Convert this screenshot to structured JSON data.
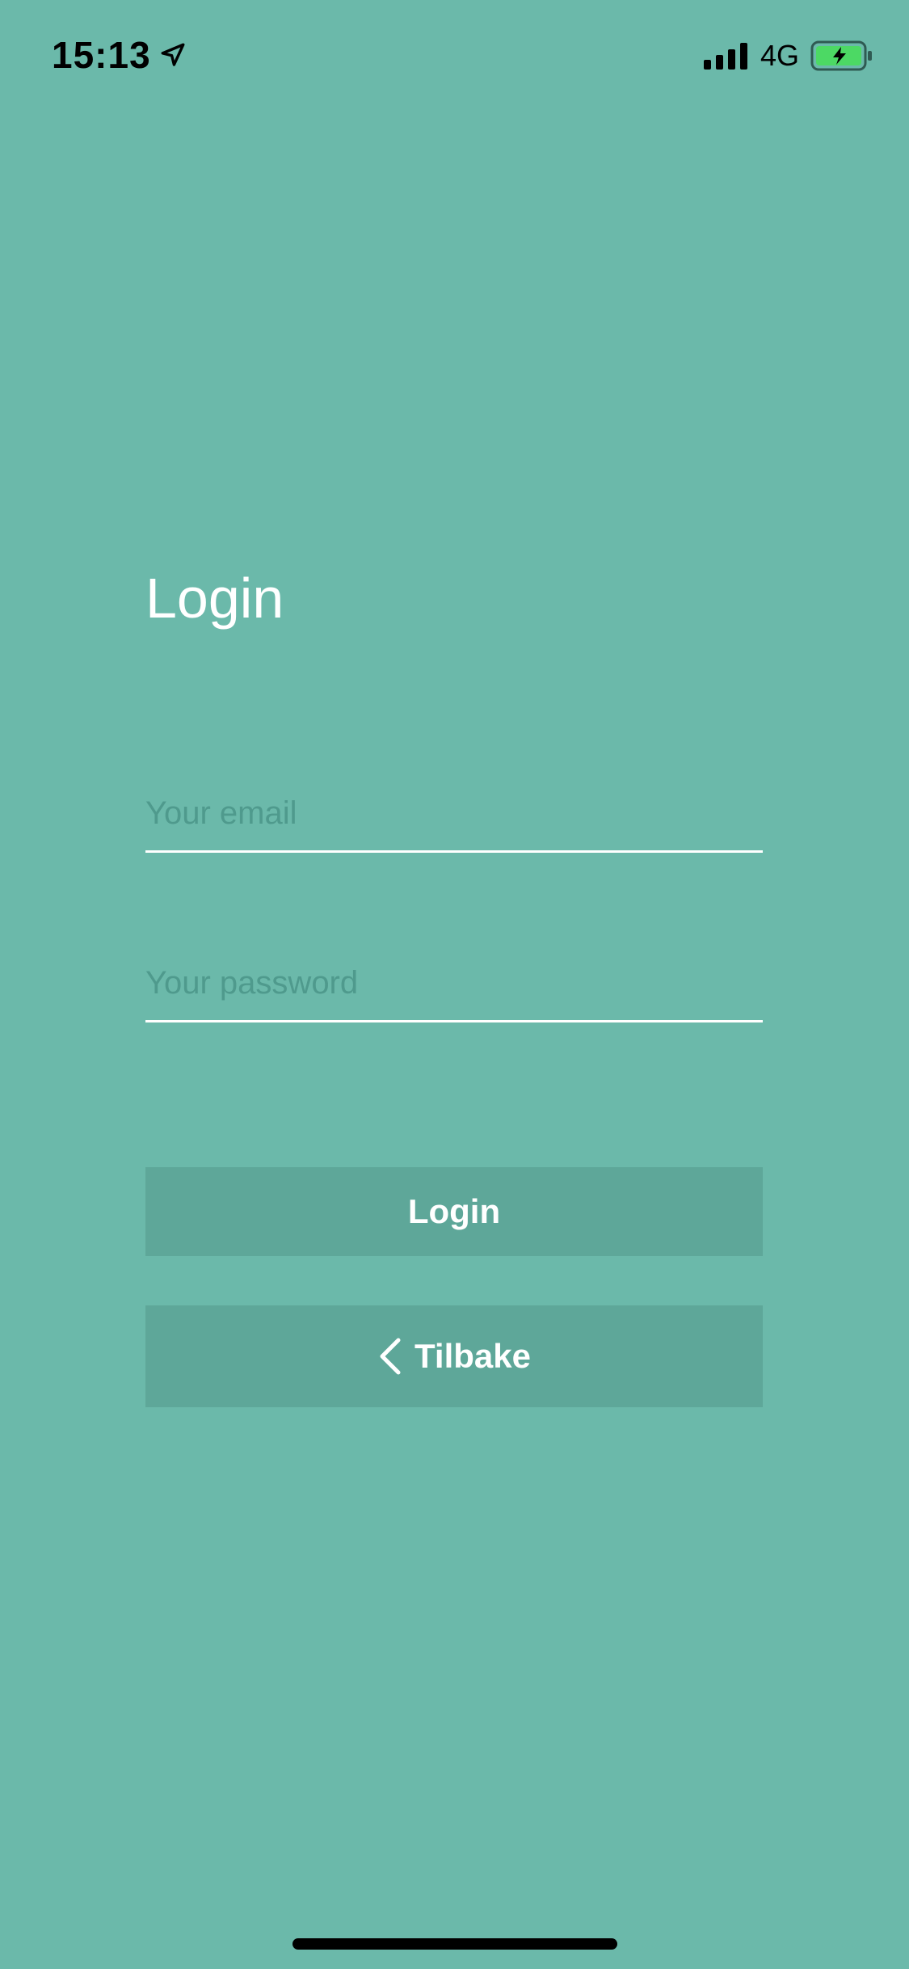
{
  "status_bar": {
    "time": "15:13",
    "network": "4G"
  },
  "login_form": {
    "title": "Login",
    "email_placeholder": "Your email",
    "email_value": "",
    "password_placeholder": "Your password",
    "password_value": "",
    "login_button_label": "Login",
    "back_button_label": "Tilbake"
  },
  "icons": {
    "location": "location-arrow-icon",
    "signal": "cellular-signal-icon",
    "battery": "battery-charging-icon",
    "back": "chevron-left-icon"
  },
  "colors": {
    "background": "#6bb9aa",
    "button": "#5ea799",
    "placeholder": "#4f9a8d",
    "battery_fill": "#4cd964"
  }
}
